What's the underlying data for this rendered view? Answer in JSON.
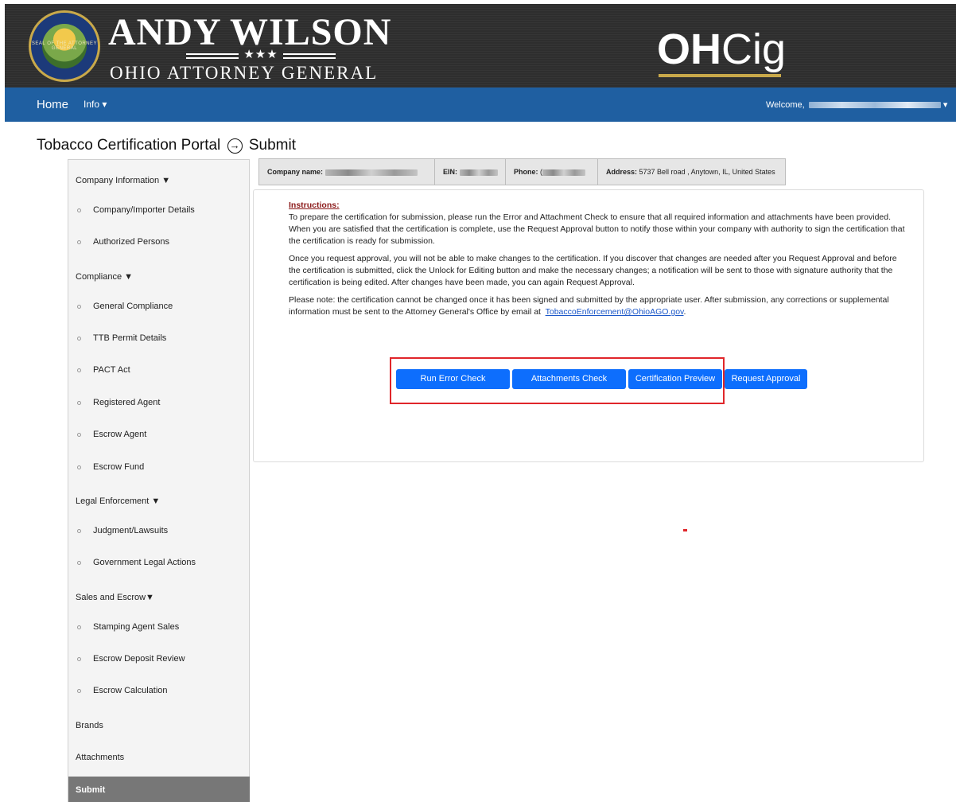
{
  "header": {
    "seal_text": "SEAL OF THE ATTORNEY GENERAL",
    "brand_name": "ANDY WILSON",
    "brand_stars": "★★★",
    "brand_sub": "OHIO ATTORNEY GENERAL",
    "app_logo_oh": "OH",
    "app_logo_cig": "Cig"
  },
  "nav": {
    "home": "Home",
    "info": "Info ▾",
    "welcome": "Welcome,",
    "welcome_caret": "▾"
  },
  "page": {
    "title_left": "Tobacco Certification Portal",
    "title_arrow": "→",
    "title_right": "Submit"
  },
  "sidebar": {
    "company_info": "Company Information ▼",
    "company_importer": "Company/Importer Details",
    "authorized_persons": "Authorized Persons",
    "compliance": "Compliance ▼",
    "general_compliance": "General Compliance",
    "ttb_permit": "TTB Permit Details",
    "pact_act": "PACT Act",
    "registered_agent": "Registered Agent",
    "escrow_agent": "Escrow Agent",
    "escrow_fund": "Escrow Fund",
    "legal_enforcement": "Legal Enforcement ▼",
    "judgment_lawsuits": "Judgment/Lawsuits",
    "gov_legal_actions": "Government Legal Actions",
    "sales_escrow": "Sales and Escrow▼",
    "stamping_agent_sales": "Stamping Agent Sales",
    "escrow_deposit_review": "Escrow Deposit Review",
    "escrow_calculation": "Escrow Calculation",
    "brands": "Brands",
    "attachments": "Attachments",
    "submit": "Submit"
  },
  "infobar": {
    "company_label": "Company name:",
    "ein_label": "EIN:",
    "phone_label": "Phone:",
    "phone_prefix": "(",
    "address_label": "Address:",
    "address_value": "5737 Bell road , Anytown, IL, United States"
  },
  "instructions": {
    "heading": "Instructions:",
    "p1": "To prepare the certification for submission, please run the Error and Attachment Check to ensure that all required information and attachments have been provided. When you are satisfied that the certification is complete, use the Request Approval button to notify those within your company with authority to sign the certification that the certification is ready for submission.",
    "p2": "Once you request approval, you will not be able to make changes to the certification. If you discover that changes are needed after you Request Approval and before the certification is submitted, click the Unlock for Editing button and make the necessary changes; a notification will be sent to those with signature authority that the certification is being edited. After changes have been made, you can again Request Approval.",
    "p3_prefix": "Please note: the certification cannot be changed once it has been signed and submitted by the appropriate user. After submission, any corrections or supplemental information must be sent to the Attorney General's Office by email at",
    "p3_email": "TobaccoEnforcement@OhioAGO.gov",
    "p3_suffix": "."
  },
  "buttons": {
    "run_error_check": "Run Error Check",
    "attachments_check": "Attachments Check",
    "certification_preview": "Certification Preview",
    "request_approval": "Request Approval"
  },
  "colors": {
    "banner": "#2e2e2e",
    "navbar": "#1f5fa1",
    "button": "#0d6efd",
    "highlight": "#e0262a",
    "sidebar_active": "#777777"
  }
}
